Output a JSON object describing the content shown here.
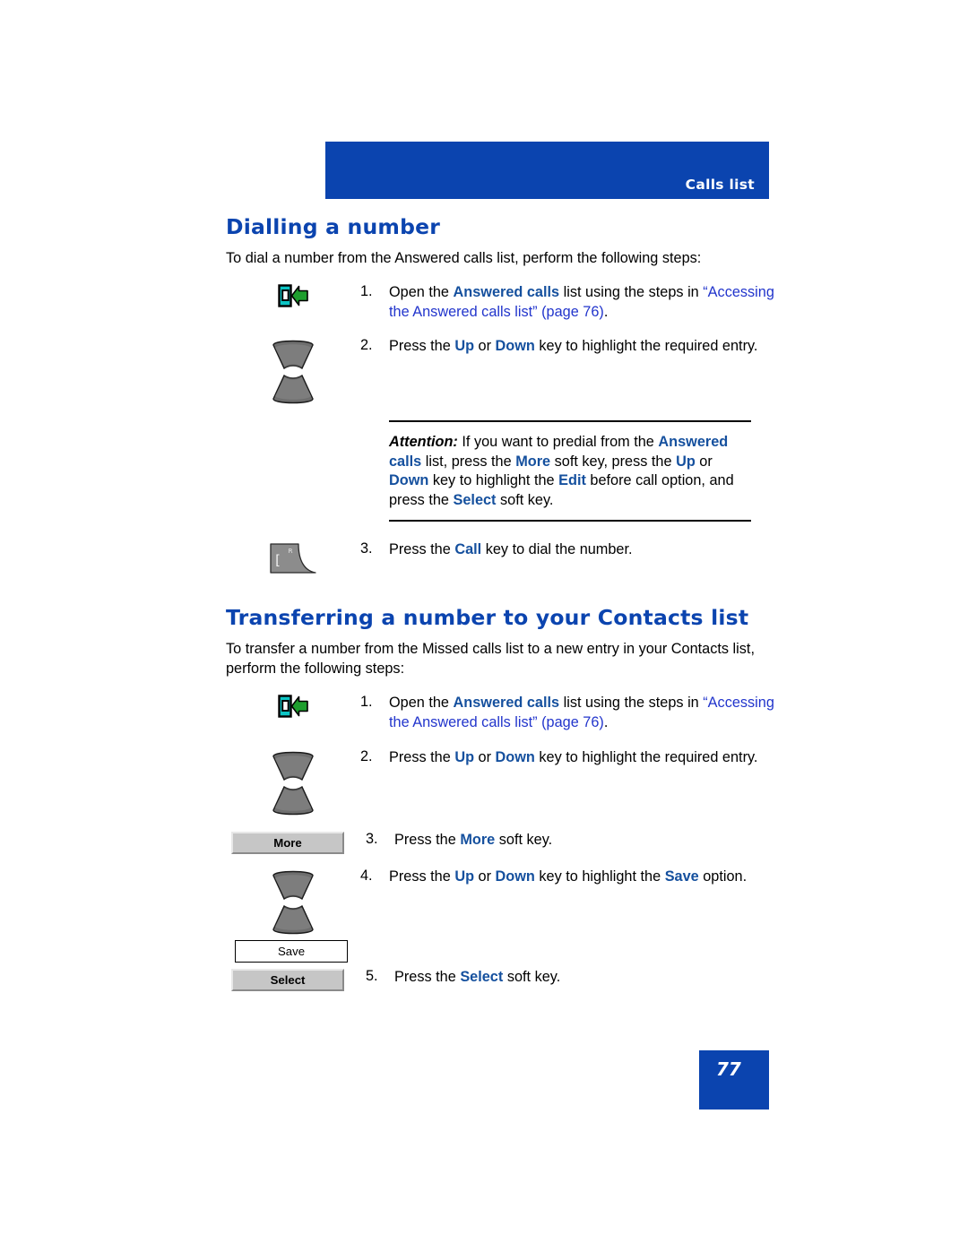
{
  "header": {
    "title": "Calls list",
    "bar_color": "#0B44AF"
  },
  "colors": {
    "brand_blue": "#0B44AF",
    "highlight_blue": "#15509E",
    "xref_blue": "#2235CC",
    "softkey_gray": "#C6C6C6"
  },
  "sections": [
    {
      "heading": "Dialling a number",
      "intro": "To dial a number from the Answered calls list, perform the following steps:",
      "steps": [
        {
          "number": "1.",
          "icon": "answered-calls-icon",
          "text_parts": [
            {
              "t": "Open the ",
              "style": "plain"
            },
            {
              "t": "Answered calls",
              "style": "bold-blue"
            },
            {
              "t": " list using the steps in ",
              "style": "plain"
            },
            {
              "t": "“Accessing the Answered calls list” (page 76)",
              "style": "xref"
            },
            {
              "t": ".",
              "style": "plain"
            }
          ]
        },
        {
          "number": "2.",
          "icon": "navigation-keys-icon",
          "text_parts": [
            {
              "t": "Press the ",
              "style": "plain"
            },
            {
              "t": "Up",
              "style": "bold-blue"
            },
            {
              "t": " or ",
              "style": "plain"
            },
            {
              "t": "Down",
              "style": "bold-blue"
            },
            {
              "t": " key to highlight the required entry.",
              "style": "plain"
            }
          ]
        },
        {
          "number": "3.",
          "icon": "call-key-icon",
          "text_parts": [
            {
              "t": "Press the ",
              "style": "plain"
            },
            {
              "t": "Call",
              "style": "bold-blue"
            },
            {
              "t": " key to dial the number.",
              "style": "plain"
            }
          ]
        }
      ],
      "attention": {
        "label": "Attention:",
        "parts": [
          {
            "t": " If you want to predial from the ",
            "style": "plain"
          },
          {
            "t": "Answered calls",
            "style": "bold-blue"
          },
          {
            "t": " list, press the ",
            "style": "plain"
          },
          {
            "t": "More",
            "style": "bold-blue"
          },
          {
            "t": " soft key, press the ",
            "style": "plain"
          },
          {
            "t": "Up",
            "style": "bold-blue"
          },
          {
            "t": " or ",
            "style": "plain"
          },
          {
            "t": "Down",
            "style": "bold-blue"
          },
          {
            "t": " key to highlight the ",
            "style": "plain"
          },
          {
            "t": "Edit",
            "style": "bold-blue"
          },
          {
            "t": " before call option, and press the ",
            "style": "plain"
          },
          {
            "t": "Select",
            "style": "bold-blue"
          },
          {
            "t": " soft key.",
            "style": "plain"
          }
        ]
      }
    },
    {
      "heading": "Transferring a number to your Contacts list",
      "intro": "To transfer a number from the Missed calls list to a new entry in your Contacts list, perform the following steps:",
      "steps": [
        {
          "number": "1.",
          "icon": "answered-calls-icon",
          "text_parts": [
            {
              "t": "Open the ",
              "style": "plain"
            },
            {
              "t": "Answered calls",
              "style": "bold-blue"
            },
            {
              "t": " list using the steps in ",
              "style": "plain"
            },
            {
              "t": "“Accessing the Answered calls list” (page 76)",
              "style": "xref"
            },
            {
              "t": ".",
              "style": "plain"
            }
          ]
        },
        {
          "number": "2.",
          "icon": "navigation-keys-icon",
          "text_parts": [
            {
              "t": "Press the ",
              "style": "plain"
            },
            {
              "t": "Up",
              "style": "bold-blue"
            },
            {
              "t": " or ",
              "style": "plain"
            },
            {
              "t": "Down",
              "style": "bold-blue"
            },
            {
              "t": " key to highlight the required entry.",
              "style": "plain"
            }
          ]
        },
        {
          "number": "3.",
          "icon": "softkey-more",
          "text_parts": [
            {
              "t": "Press the ",
              "style": "plain"
            },
            {
              "t": "More",
              "style": "bold-blue"
            },
            {
              "t": " soft key.",
              "style": "plain"
            }
          ]
        },
        {
          "number": "4.",
          "icon": "navigation-keys-icon",
          "text_parts": [
            {
              "t": "Press the ",
              "style": "plain"
            },
            {
              "t": "Up",
              "style": "bold-blue"
            },
            {
              "t": " or ",
              "style": "plain"
            },
            {
              "t": "Down",
              "style": "bold-blue"
            },
            {
              "t": " key to highlight the ",
              "style": "plain"
            },
            {
              "t": "Save",
              "style": "bold-blue"
            },
            {
              "t": " option.",
              "style": "plain"
            }
          ]
        },
        {
          "number": "5.",
          "icon": "softkey-select",
          "text_parts": [
            {
              "t": "Press the ",
              "style": "plain"
            },
            {
              "t": "Select",
              "style": "bold-blue"
            },
            {
              "t": " soft key.",
              "style": "plain"
            }
          ]
        }
      ]
    }
  ],
  "softkeys": {
    "more": "More",
    "save": "Save",
    "select": "Select"
  },
  "footer": {
    "page_number": "77"
  }
}
